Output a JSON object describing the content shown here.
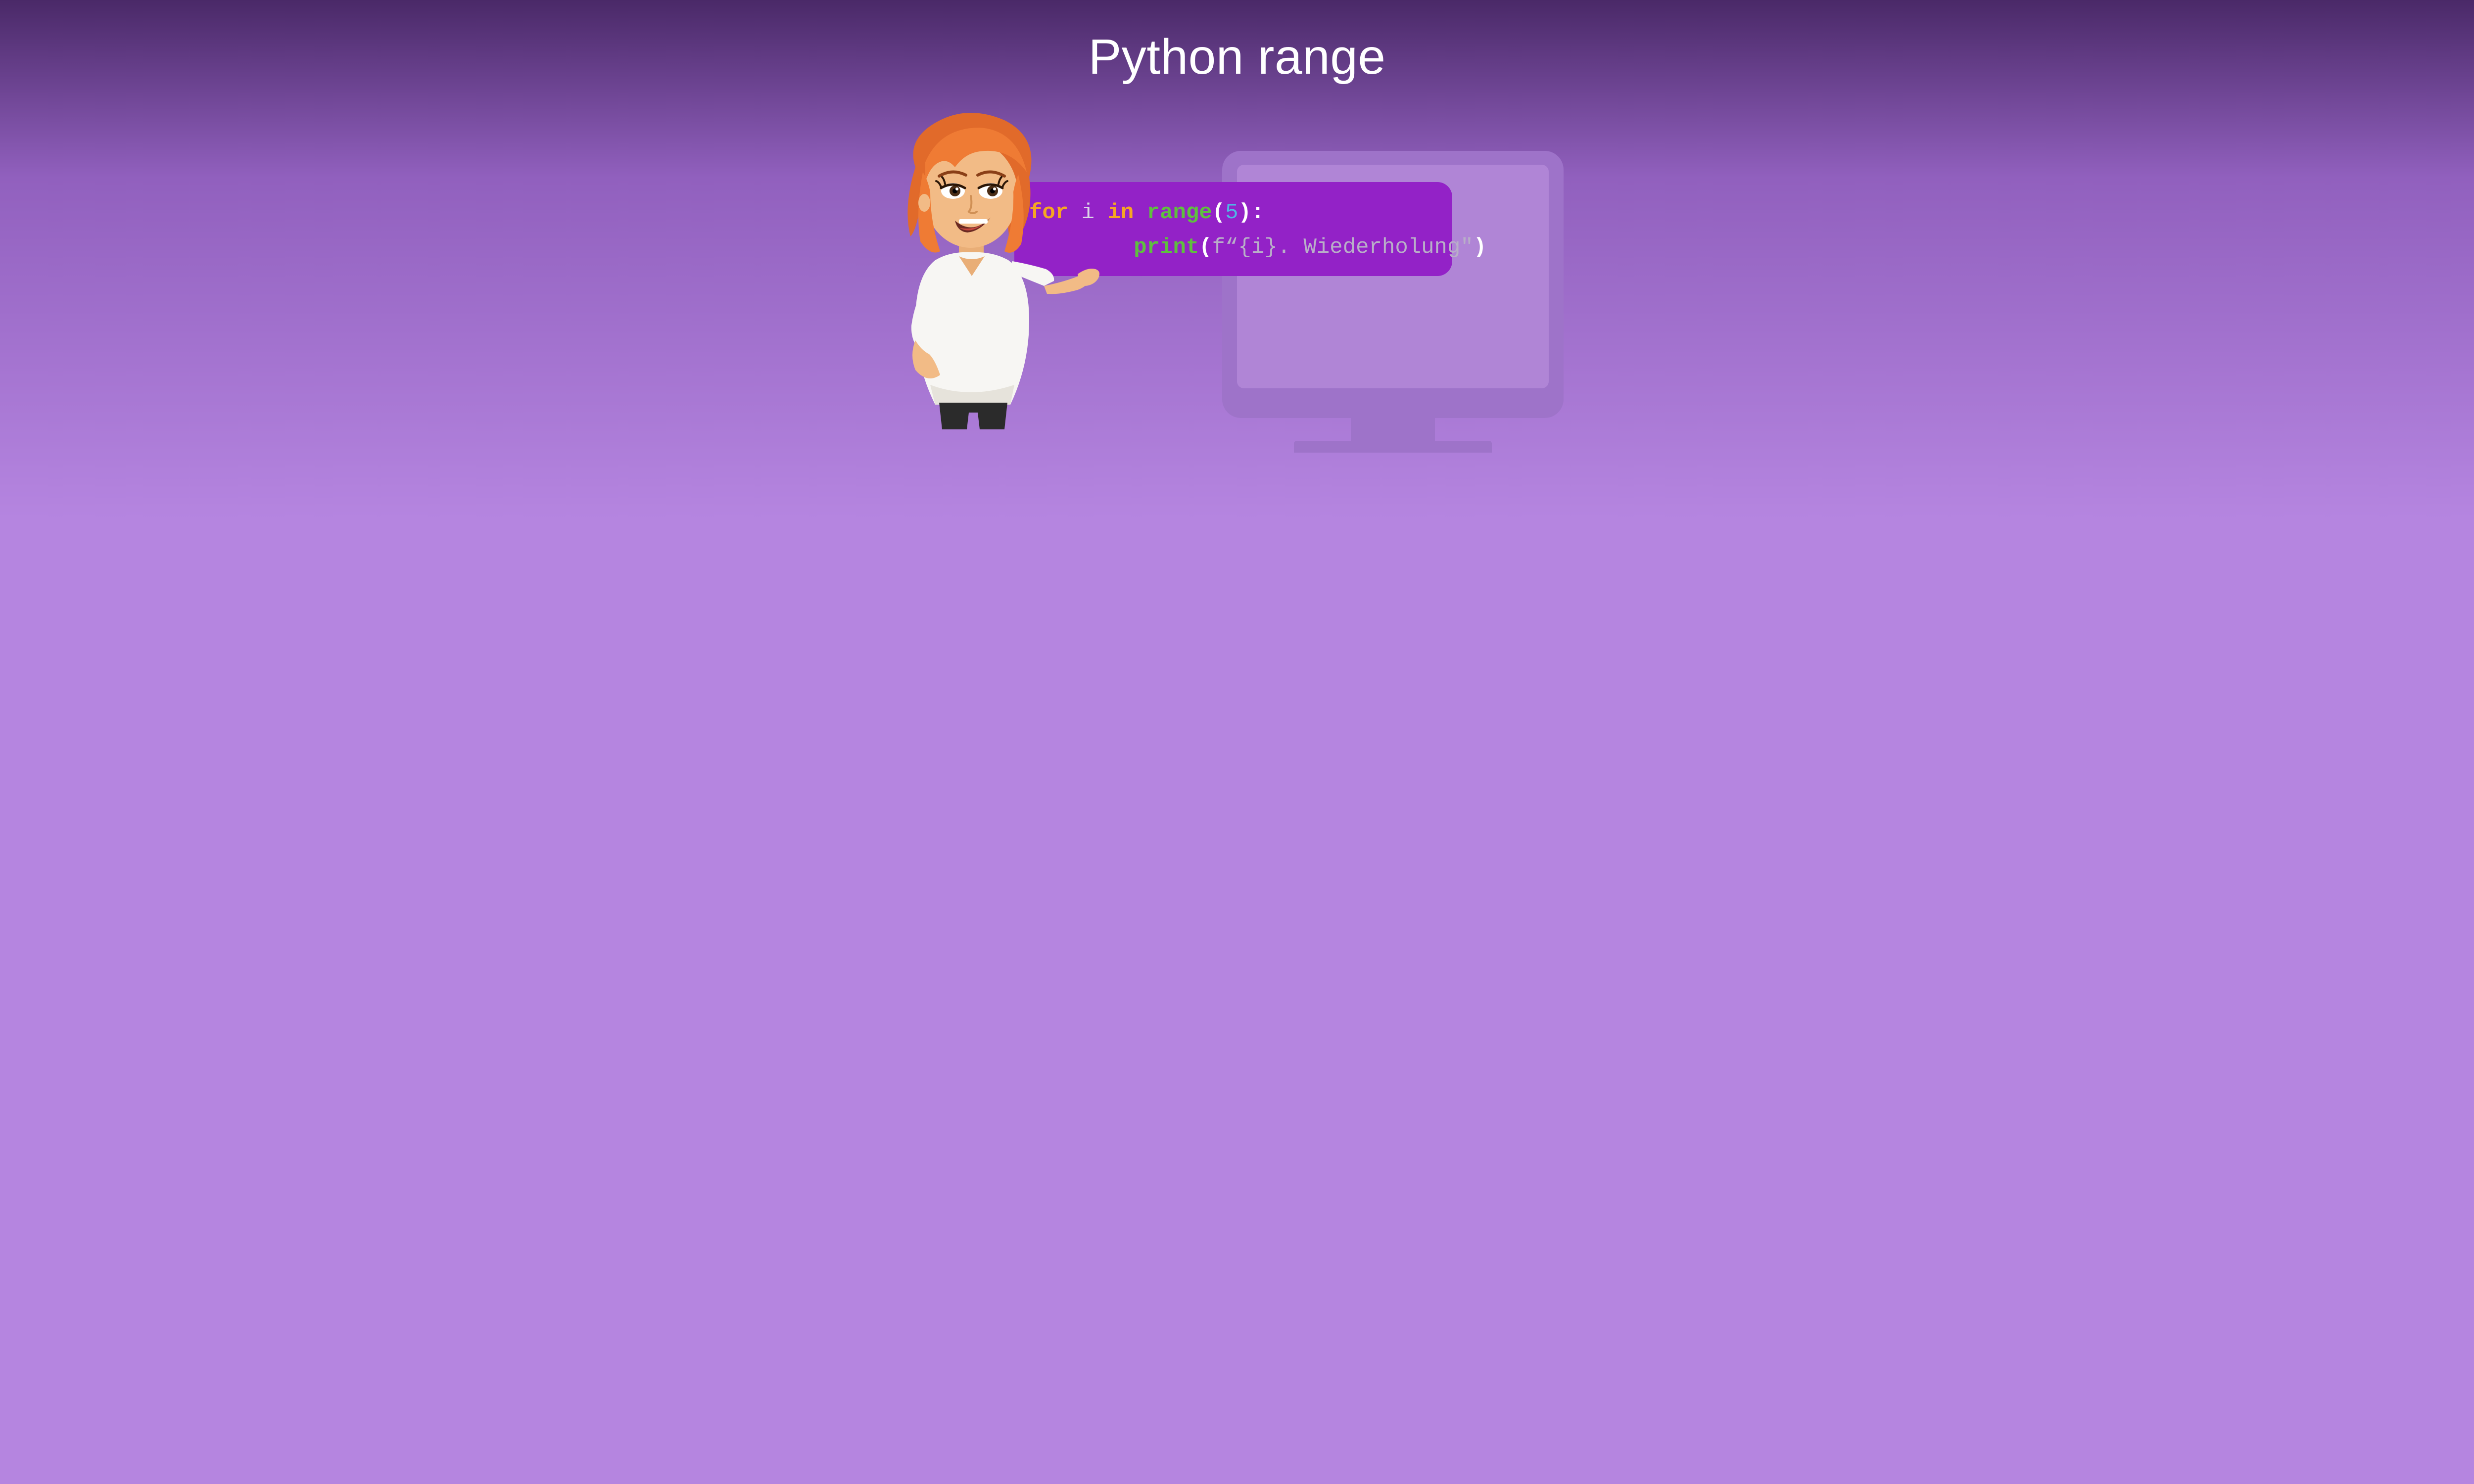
{
  "title": "Python range",
  "code": {
    "line1": {
      "for": "for",
      "i": "i",
      "in": "in",
      "range": "range",
      "lparen": "(",
      "num": "5",
      "rparen": ")",
      "colon": ":"
    },
    "line2": {
      "indent": "        ",
      "print": "print",
      "lparen": "(",
      "fstring_prefix": "f“{i}. Wiederholung\"",
      "rparen": ")"
    }
  },
  "character": {
    "description": "cartoon-woman-presenter"
  }
}
